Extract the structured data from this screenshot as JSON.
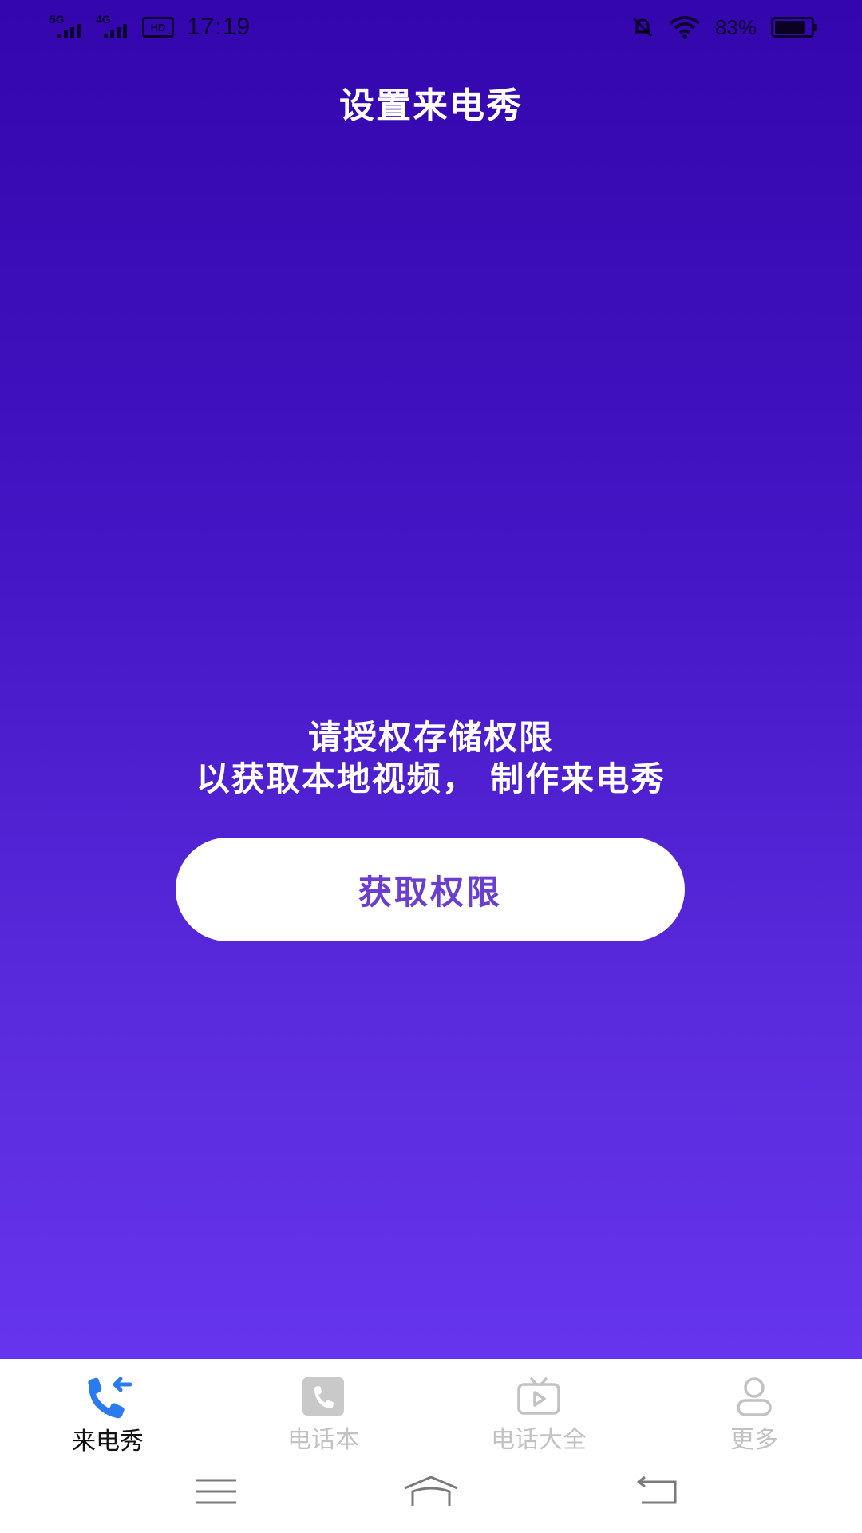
{
  "status_bar": {
    "signal1_label": "5G",
    "signal2_label": "4G",
    "hd_label": "HD",
    "time": "17:19",
    "battery_percent_text": "83%",
    "battery_level": 0.83
  },
  "header": {
    "title": "设置来电秀"
  },
  "main": {
    "prompt_line1": "请授权存储权限",
    "prompt_line2": "以获取本地视频， 制作来电秀",
    "grant_button_label": "获取权限"
  },
  "tabs": [
    {
      "label": "来电秀",
      "icon": "phone-incoming-icon",
      "active": true
    },
    {
      "label": "电话本",
      "icon": "phonebook-icon",
      "active": false
    },
    {
      "label": "电话大全",
      "icon": "tv-play-icon",
      "active": false
    },
    {
      "label": "更多",
      "icon": "person-icon",
      "active": false
    }
  ],
  "nav": {
    "menu": "menu-icon",
    "home": "home-icon",
    "back": "back-icon"
  },
  "colors": {
    "gradient_top": "#3406ad",
    "gradient_bottom": "#6634ee",
    "button_text": "#6a3fd0",
    "active_icon": "#2b7bf0",
    "inactive": "#c2c2c2"
  }
}
